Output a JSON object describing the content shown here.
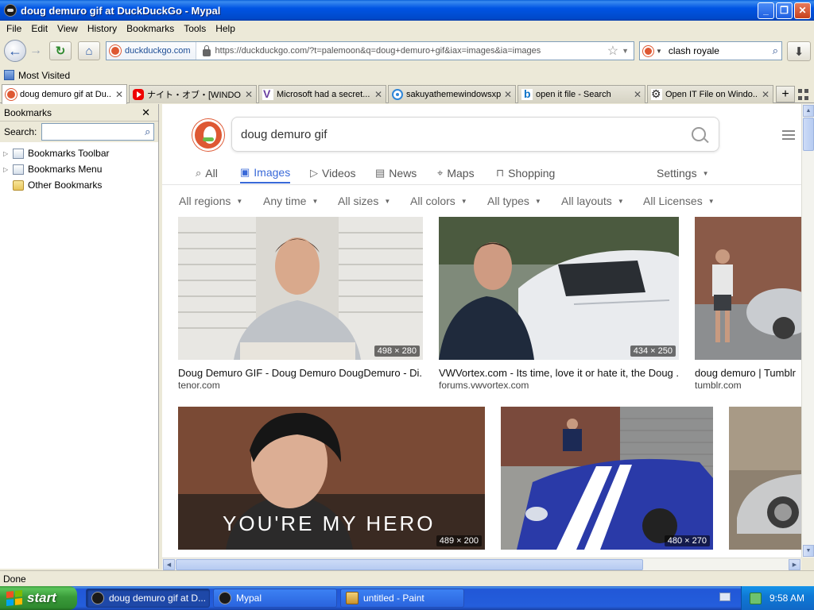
{
  "window": {
    "title": "doug demuro gif at DuckDuckGo - Mypal"
  },
  "menu": [
    "File",
    "Edit",
    "View",
    "History",
    "Bookmarks",
    "Tools",
    "Help"
  ],
  "urlbar": {
    "domain": "duckduckgo.com",
    "url": "https://duckduckgo.com/?t=palemoon&q=doug+demuro+gif&iax=images&ia=images"
  },
  "searchbar": {
    "value": "clash royale"
  },
  "bookmarks_toolbar": {
    "most_visited": "Most Visited"
  },
  "tabs": [
    {
      "label": "doug demuro gif at Du...",
      "icon": "duckduckgo-icon",
      "active": true
    },
    {
      "label": "ナイト・オブ・[WINDO...",
      "icon": "youtube-icon",
      "active": false
    },
    {
      "label": "Microsoft had a secret...",
      "icon": "vice-icon",
      "active": false
    },
    {
      "label": "sakuyathemewindowsxp",
      "icon": "eye-icon",
      "active": false
    },
    {
      "label": "open it file - Search",
      "icon": "bing-icon",
      "active": false
    },
    {
      "label": "Open IT File on Windo...",
      "icon": "gear-icon",
      "active": false
    }
  ],
  "sidebar": {
    "title": "Bookmarks",
    "search_label": "Search:",
    "items": [
      {
        "label": "Bookmarks Toolbar",
        "expandable": true
      },
      {
        "label": "Bookmarks Menu",
        "expandable": true
      },
      {
        "label": "Other Bookmarks",
        "expandable": false
      }
    ]
  },
  "ddg": {
    "query": "doug demuro gif",
    "nav": [
      "All",
      "Images",
      "Videos",
      "News",
      "Maps",
      "Shopping"
    ],
    "active_nav": "Images",
    "settings_label": "Settings",
    "filters": [
      "All regions",
      "Any time",
      "All sizes",
      "All colors",
      "All types",
      "All layouts",
      "All Licenses"
    ],
    "results": [
      {
        "title": "Doug Demuro GIF - Doug Demuro DougDemuro - Di...",
        "source": "tenor.com",
        "dims": "498 × 280"
      },
      {
        "title": "VWVortex.com - Its time, love it or hate it, the Doug ...",
        "source": "forums.vwvortex.com",
        "dims": "434 × 250"
      },
      {
        "title": "doug demuro | Tumblr",
        "source": "tumblr.com",
        "dims": ""
      },
      {
        "title": "",
        "source": "",
        "dims": "489 × 200",
        "overlay_text": "YOU'RE MY HERO"
      },
      {
        "title": "",
        "source": "",
        "dims": "480 × 270"
      },
      {
        "title": "",
        "source": "",
        "dims": ""
      }
    ]
  },
  "status": {
    "text": "Done"
  },
  "taskbar": {
    "start_label": "start",
    "tasks": [
      {
        "label": "doug demuro gif at D...",
        "active": true
      },
      {
        "label": "Mypal",
        "active": false
      },
      {
        "label": "untitled - Paint",
        "active": false
      }
    ],
    "clock": "9:58 AM"
  },
  "colors": {
    "ddg_orange": "#de5833",
    "ddg_blue": "#3969d8",
    "xp_blue": "#0054e3",
    "xp_green": "#3a9b3a"
  }
}
